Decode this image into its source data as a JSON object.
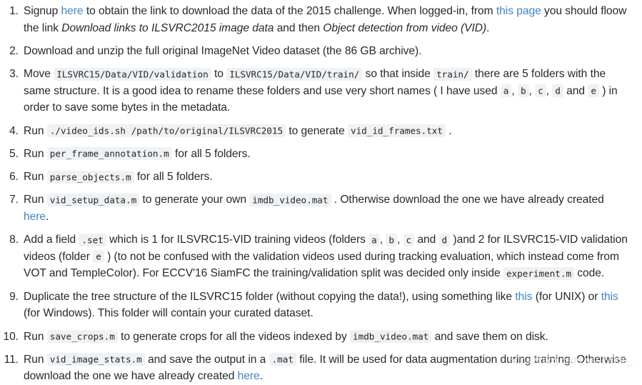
{
  "document": {
    "type": "ordered-instruction-list",
    "text_color": "#24292e",
    "link_color": "#4183c4",
    "code_background": "#eff1f2",
    "page_background": "#ffffff"
  },
  "watermark": {
    "text": "https://blog.csdn.net/ZZXin_",
    "color": "#e3e3e3"
  },
  "steps": [
    {
      "number": "1.",
      "parts": {
        "t1": "Signup ",
        "link1": "here",
        "t2": " to obtain the link to download the data of the 2015 challenge. When logged-in, from ",
        "link2": "this page",
        "t3": " you should floow the link ",
        "em1": "Download links to ILSVRC2015 image data",
        "t4": " and then ",
        "em2": "Object detection from video (VID)",
        "t5": "."
      }
    },
    {
      "number": "2.",
      "parts": {
        "t1": "Download and unzip the full original ImageNet Video dataset (the 86 GB archive)."
      }
    },
    {
      "number": "3.",
      "parts": {
        "t1": "Move ",
        "code1": "ILSVRC15/Data/VID/validation",
        "t2": " to ",
        "code2": "ILSVRC15/Data/VID/train/",
        "t3": " so that inside ",
        "code3": "train/",
        "t4": " there are 5 folders with the same structure. It is a good idea to rename these folders and use very short names ( I have used ",
        "code4": "a",
        "t5": ", ",
        "code5": "b",
        "t6": ", ",
        "code6": "c",
        "t7": ", ",
        "code7": "d",
        "t8": " and ",
        "code8": "e",
        "t9": " ) in order to save some bytes in the metadata."
      }
    },
    {
      "number": "4.",
      "parts": {
        "t1": "Run ",
        "code1": "./video_ids.sh /path/to/original/ILSVRC2015",
        "t2": " to generate ",
        "code2": "vid_id_frames.txt",
        "t3": " ."
      }
    },
    {
      "number": "5.",
      "parts": {
        "t1": "Run ",
        "code1": "per_frame_annotation.m",
        "t2": " for all 5 folders."
      }
    },
    {
      "number": "6.",
      "parts": {
        "t1": "Run ",
        "code1": "parse_objects.m",
        "t2": " for all 5 folders."
      }
    },
    {
      "number": "7.",
      "parts": {
        "t1": "Run ",
        "code1": "vid_setup_data.m",
        "t2": " to generate your own ",
        "code2": "imdb_video.mat",
        "t3": " . Otherwise download the one we have already created ",
        "link1": "here",
        "t4": "."
      }
    },
    {
      "number": "8.",
      "parts": {
        "t1": "Add a field ",
        "code1": ".set",
        "t2": " which is 1 for ILSVRC15-VID training videos (folders ",
        "code2": "a",
        "t3": ", ",
        "code3": "b",
        "t4": ", ",
        "code4": "c",
        "t5": " and ",
        "code5": "d",
        "t6": " )and 2 for ILSVRC15-VID validation videos (folder ",
        "code6": "e",
        "t7": " ) (to not be confused with the validation videos used during tracking evaluation, which instead come from VOT and TempleColor). For ECCV'16 SiamFC the training/validation split was decided only inside ",
        "code7": "experiment.m",
        "t8": " code."
      }
    },
    {
      "number": "9.",
      "parts": {
        "t1": "Duplicate the tree structure of the ILSVRC15 folder (without copying the data!), using something like ",
        "link1": "this",
        "t2": " (for UNIX) or ",
        "link2": "this",
        "t3": " (for Windows). This folder will contain your curated dataset."
      }
    },
    {
      "number": "10.",
      "parts": {
        "t1": "Run ",
        "code1": "save_crops.m",
        "t2": " to generate crops for all the videos indexed by ",
        "code2": "imdb_video.mat",
        "t3": " and save them on disk."
      }
    },
    {
      "number": "11.",
      "parts": {
        "t1": "Run ",
        "code1": "vid_image_stats.m",
        "t2": " and save the output in a ",
        "code2": ".mat",
        "t3": " file. It will be used for data augmentation during training. Otherwise download the one we have already created ",
        "link1": "here",
        "t4": "."
      }
    }
  ]
}
